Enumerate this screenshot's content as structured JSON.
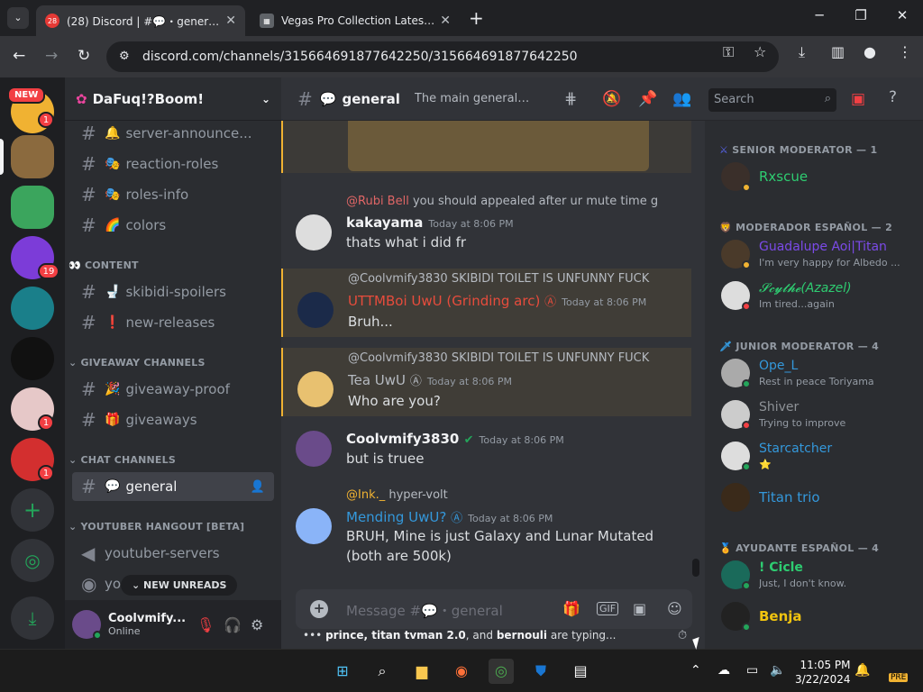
{
  "browser": {
    "tabs": [
      {
        "title": "(28) Discord | #💬・general | Da",
        "badge": "28"
      },
      {
        "title": "Vegas Pro Collection Latest Buil"
      }
    ],
    "url": "discord.com/channels/315664691877642250/315664691877642250"
  },
  "servers": {
    "new_label": "NEW",
    "badges": [
      "1",
      "19",
      "1",
      "1"
    ]
  },
  "sidebar": {
    "server_name": "DaFuq!?Boom!",
    "channels_top": [
      {
        "emoji": "🔔",
        "name": "server-announce..."
      },
      {
        "emoji": "🎭",
        "name": "reaction-roles"
      },
      {
        "emoji": "🎭",
        "name": "roles-info"
      },
      {
        "emoji": "🌈",
        "name": "colors"
      }
    ],
    "cat_content": "CONTENT",
    "channels_content": [
      {
        "emoji": "🚽",
        "name": "skibidi-spoilers"
      },
      {
        "emoji": "❗",
        "name": "new-releases"
      }
    ],
    "cat_giveaway": "GIVEAWAY CHANNELS",
    "channels_giveaway": [
      {
        "emoji": "🎉",
        "name": "giveaway-proof"
      },
      {
        "emoji": "🎁",
        "name": "giveaways"
      }
    ],
    "cat_chat": "CHAT CHANNELS",
    "active_channel": {
      "emoji": "💬",
      "name": "general"
    },
    "cat_youtuber": "YOUTUBER HANGOUT [BETA]",
    "channels_youtuber": [
      {
        "name": "youtuber-servers"
      },
      {
        "name": "you"
      }
    ],
    "new_unreads": "NEW UNREADS",
    "user": {
      "name": "Coolvmify...",
      "status": "Online"
    }
  },
  "chat": {
    "channel": "general",
    "topic": "The main general ch...",
    "messages": [
      {
        "reply_user": "@Rubi Bell",
        "reply_text": "you should appealed after ur mute time g",
        "author": "kakayama",
        "time": "Today at 8:06 PM",
        "text": "thats what i did fr"
      },
      {
        "reply_user": "@Coolvmify3830",
        "reply_text": "SKIBIDI TOILET IS UNFUNNY FUCK",
        "author": "UTTMBoi UwU (Grinding arc)",
        "time": "Today at 8:06 PM",
        "text": "Bruh..."
      },
      {
        "reply_user": "@Coolvmify3830",
        "reply_text": "SKIBIDI TOILET IS UNFUNNY FUCK",
        "author": "Tea UwU",
        "time": "Today at 8:06 PM",
        "text": "Who are you?"
      },
      {
        "author": "Coolvmify3830",
        "time": "Today at 8:06 PM",
        "text": "but is truee"
      },
      {
        "reply_user": "@Ink._",
        "reply_text": "hyper-volt",
        "author": "Mending UwU?",
        "time": "Today at 8:06 PM",
        "text": "BRUH, Mine is just Galaxy and Lunar Mutated (both are 500k)"
      }
    ],
    "composer_placeholder": "Message #💬・general",
    "typing_users": "prince, titan tvman 2.0",
    "typing_and": ", and",
    "typing_last": "bernouli",
    "typing_suffix": "are typing..."
  },
  "search_placeholder": "Search",
  "members": {
    "groups": [
      {
        "title": "SENIOR MODERATOR — 1",
        "members": [
          {
            "name": "Rxscue",
            "color": "#2ecc71"
          }
        ]
      },
      {
        "title": "MODERADOR ESPAÑOL — 2",
        "members": [
          {
            "name": "Guadalupe Aoi|Titan",
            "sub": "I'm very happy for Albedo ...",
            "color": "#7b4ae8"
          },
          {
            "name": "𝓢𝓬𝔂𝓽𝓱𝓮(Azazel)",
            "sub": "Im tired...again",
            "color": "#2ecc71"
          }
        ]
      },
      {
        "title": "JUNIOR MODERATOR — 4",
        "members": [
          {
            "name": "Ope_L",
            "sub": "Rest in peace Toriyama",
            "color": "#3498db"
          },
          {
            "name": "Shiver",
            "sub": "Trying to improve",
            "color": "#8e9297"
          },
          {
            "name": "Starcatcher",
            "sub": "⭐",
            "color": "#3498db"
          },
          {
            "name": "Titan trio",
            "color": "#3498db"
          }
        ]
      },
      {
        "title": "AYUDANTE ESPAÑOL — 4",
        "members": [
          {
            "name": "! Cicle",
            "sub": "Just, I don't know.",
            "color": "#2ecc71"
          },
          {
            "name": "Benja",
            "color": "#f1c40f"
          }
        ]
      }
    ]
  },
  "taskbar": {
    "time": "11:05 PM",
    "date": "3/22/2024"
  }
}
